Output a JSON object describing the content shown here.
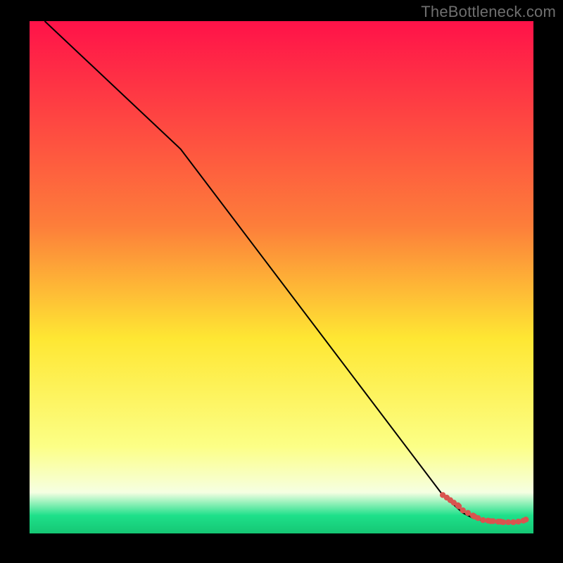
{
  "attribution": "TheBottleneck.com",
  "colors": {
    "top": "#ff1249",
    "mid_upper": "#fd7e3a",
    "mid": "#fee733",
    "mid_lower": "#fcff86",
    "pale_band": "#f6ffe2",
    "green": "#1ee08a",
    "line": "#000000",
    "points": "#d9544f",
    "frame": "#000000"
  },
  "chart_data": {
    "type": "line",
    "title": "",
    "xlabel": "",
    "ylabel": "",
    "xlim": [
      0,
      100
    ],
    "ylim": [
      0,
      100
    ],
    "series": [
      {
        "name": "bottleneck-curve",
        "x": [
          3,
          30,
          82,
          86,
          88,
          90,
          92,
          95,
          97,
          98.5
        ],
        "values": [
          100,
          75,
          7.5,
          4,
          3,
          2.5,
          2.3,
          2.2,
          2.3,
          2.7
        ]
      }
    ],
    "points": {
      "name": "data-points",
      "x": [
        82,
        82.8,
        83.5,
        84.2,
        85,
        85.2,
        86,
        87,
        88,
        88.3,
        89,
        90,
        91,
        91.5,
        92,
        93,
        93.5,
        94,
        95,
        96,
        97,
        98,
        98.5
      ],
      "values": [
        7.5,
        7,
        6.5,
        6,
        5.5,
        5.3,
        4.5,
        4,
        3.5,
        3.3,
        3,
        2.6,
        2.5,
        2.4,
        2.4,
        2.3,
        2.3,
        2.2,
        2.2,
        2.2,
        2.3,
        2.5,
        2.7
      ]
    },
    "gradient_stops": [
      {
        "offset": 0,
        "color": "#ff1249"
      },
      {
        "offset": 40,
        "color": "#fd7e3a"
      },
      {
        "offset": 62,
        "color": "#fee733"
      },
      {
        "offset": 83,
        "color": "#fcff86"
      },
      {
        "offset": 92,
        "color": "#f6ffe2"
      },
      {
        "offset": 96.5,
        "color": "#1ee08a"
      },
      {
        "offset": 100,
        "color": "#15c774"
      }
    ]
  }
}
